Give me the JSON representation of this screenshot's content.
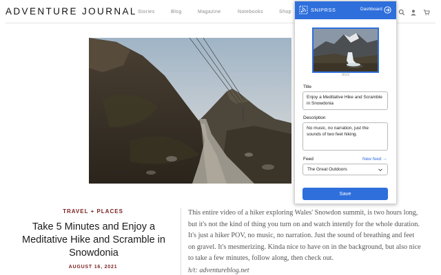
{
  "site": {
    "logo": "ADVENTURE  JOURNAL",
    "nav": [
      {
        "label": "Stories"
      },
      {
        "label": "Blog"
      },
      {
        "label": "Magazine"
      },
      {
        "label": "Notebooks"
      },
      {
        "label": "Shop"
      }
    ]
  },
  "article": {
    "category": "TRAVEL + PLACES",
    "headline": "Take 5 Minutes and Enjoy a Meditative Hike and Scramble in Snowdonia",
    "date": "AUGUST 16, 2021",
    "body": "This entire video of a hiker exploring Wales' Snowdon summit, is two hours long, but it's not the kind of thing you turn on and watch intently for the whole duration. It's just a hiker POV, no music, no narration. Just the sound of breathing and feet on gravel. It's mesmerizing. Kinda nice to have on in the background, but also nice to take a few minutes, follow along, then check out.",
    "hat_tip": "h/t: adventureblog.net"
  },
  "popup": {
    "brand": "SNIPRSS",
    "dashboard_label": "Dashboard",
    "image_counter": "3/22",
    "title_label": "Title",
    "title_value": "Enjoy a Meditative Hike and Scramble in Snowdonia",
    "description_label": "Description",
    "description_value": "No music, no narration, just the sounds of two feet hiking.",
    "feed_label": "Feed",
    "new_feed_label": "New feed →",
    "feed_value": "The Great Outdoors",
    "save_label": "Save",
    "accent_color": "#2e6fdc"
  }
}
